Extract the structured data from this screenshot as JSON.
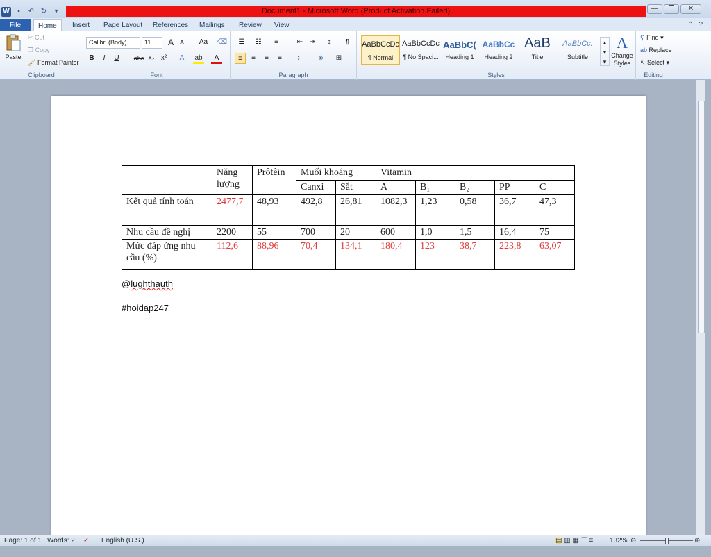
{
  "window": {
    "title": "Document1 - Microsoft Word (Product Activation Failed)",
    "controls": {
      "minimize": "—",
      "restore": "❐",
      "close": "✕"
    }
  },
  "tabs": [
    "File",
    "Home",
    "Insert",
    "Page Layout",
    "References",
    "Mailings",
    "Review",
    "View"
  ],
  "clipboard": {
    "paste": "Paste",
    "cut": "Cut",
    "copy": "Copy",
    "format_painter": "Format Painter",
    "label": "Clipboard"
  },
  "font": {
    "name": "Calibri (Body)",
    "size": "11",
    "grow": "A",
    "shrink": "A",
    "change_case": "Aa",
    "bold": "B",
    "italic": "I",
    "underline": "U",
    "strike": "abc",
    "subscript": "x₂",
    "superscript": "x²",
    "label": "Font"
  },
  "paragraph": {
    "label": "Paragraph"
  },
  "styles": {
    "items": [
      {
        "preview": "AaBbCcDc",
        "name": "¶ Normal"
      },
      {
        "preview": "AaBbCcDc",
        "name": "¶ No Spaci..."
      },
      {
        "preview": "AaBbC(",
        "name": "Heading 1"
      },
      {
        "preview": "AaBbCc",
        "name": "Heading 2"
      },
      {
        "preview": "AaB",
        "name": "Title"
      },
      {
        "preview": "AaBbCc.",
        "name": "Subtitle"
      }
    ],
    "change_styles": "Change Styles",
    "label": "Styles"
  },
  "editing": {
    "find": "Find",
    "replace": "Replace",
    "select": "Select",
    "label": "Editing"
  },
  "document": {
    "table": {
      "header_row1": [
        "",
        "Năng lượng",
        "Prôtêin",
        "Muối khoáng",
        "Vitamin"
      ],
      "header_row2": [
        "Canxi",
        "Sắt",
        "A",
        "B₁",
        "B₂",
        "PP",
        "C"
      ],
      "rows": [
        {
          "label": "Kết quả tính toán",
          "values": [
            "2477,7",
            "48,93",
            "492,8",
            "26,81",
            "1082,3",
            "1,23",
            "0,58",
            "36,7",
            "47,3"
          ],
          "red": [
            true,
            false,
            false,
            false,
            false,
            false,
            false,
            false,
            false
          ]
        },
        {
          "label": "Nhu cầu đề nghị",
          "values": [
            "2200",
            "55",
            "700",
            "20",
            "600",
            "1,0",
            "1,5",
            "16,4",
            "75"
          ],
          "red": [
            false,
            false,
            false,
            false,
            false,
            false,
            false,
            false,
            false
          ]
        },
        {
          "label": "Mức đáp ứng nhu cầu (%)",
          "values": [
            "112,6",
            "88,96",
            "70,4",
            "134,1",
            "180,4",
            "123",
            "38,7",
            "223,8",
            "63,07"
          ],
          "red": [
            true,
            true,
            true,
            true,
            true,
            true,
            true,
            true,
            true
          ]
        }
      ]
    },
    "line1_prefix": "@",
    "line1_word": "lughthauth",
    "line2": "#hoidap247"
  },
  "status": {
    "page": "Page: 1 of 1",
    "words": "Words: 2",
    "language": "English (U.S.)",
    "zoom": "132%"
  }
}
